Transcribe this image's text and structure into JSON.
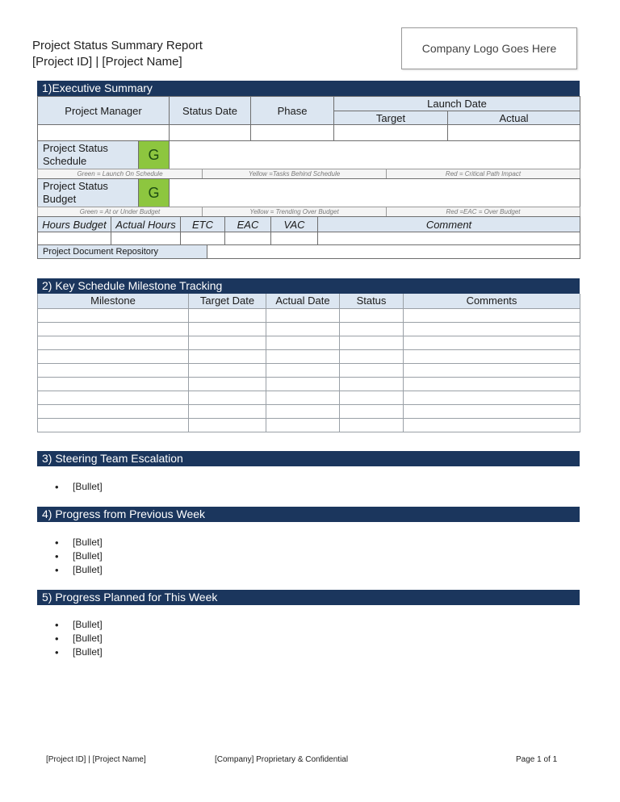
{
  "header": {
    "title": "Project Status Summary Report",
    "subtitle": "[Project ID] | [Project Name]",
    "logo_placeholder": "Company Logo Goes Here"
  },
  "section1": {
    "title": "1)Executive Summary",
    "columns": {
      "project_manager": "Project Manager",
      "status_date": "Status Date",
      "phase": "Phase",
      "launch_date": "Launch Date",
      "target": "Target",
      "actual": "Actual"
    },
    "values": {
      "project_manager": "",
      "status_date": "",
      "phase": "",
      "target": "",
      "actual": ""
    },
    "schedule": {
      "label": "Project Status Schedule",
      "status": "G",
      "status_color": "#8dc63f",
      "comment": "",
      "legend": {
        "green": "Green = Launch On Schedule",
        "yellow": "Yellow =Tasks Behind Schedule",
        "red": "Red = Critical Path Impact"
      }
    },
    "budget": {
      "label": "Project Status Budget",
      "status": "G",
      "status_color": "#8dc63f",
      "comment": "",
      "legend": {
        "green": "Green = At or Under Budget",
        "yellow": "Yellow = Trending Over Budget",
        "red": "Red =EAC = Over Budget"
      }
    },
    "hours": {
      "headers": [
        "Hours Budget",
        "Actual Hours",
        "ETC",
        "EAC",
        "VAC",
        "Comment"
      ],
      "values": [
        "",
        "",
        "",
        "",
        "",
        ""
      ]
    },
    "repository": {
      "label": "Project Document Repository",
      "value": ""
    }
  },
  "section2": {
    "title": "2) Key Schedule Milestone Tracking",
    "headers": [
      "Milestone",
      "Target Date",
      "Actual Date",
      "Status",
      "Comments"
    ],
    "rows": [
      [
        "",
        "",
        "",
        "",
        ""
      ],
      [
        "",
        "",
        "",
        "",
        ""
      ],
      [
        "",
        "",
        "",
        "",
        ""
      ],
      [
        "",
        "",
        "",
        "",
        ""
      ],
      [
        "",
        "",
        "",
        "",
        ""
      ],
      [
        "",
        "",
        "",
        "",
        ""
      ],
      [
        "",
        "",
        "",
        "",
        ""
      ],
      [
        "",
        "",
        "",
        "",
        ""
      ],
      [
        "",
        "",
        "",
        "",
        ""
      ]
    ]
  },
  "section3": {
    "title": "3) Steering Team Escalation",
    "bullets": [
      "[Bullet]"
    ]
  },
  "section4": {
    "title": "4) Progress from Previous Week",
    "bullets": [
      "[Bullet]",
      "[Bullet]",
      "[Bullet]"
    ]
  },
  "section5": {
    "title": "5) Progress Planned for This Week",
    "bullets": [
      "[Bullet]",
      "[Bullet]",
      "[Bullet]"
    ]
  },
  "footer": {
    "left": "[Project ID] | [Project Name]",
    "center": "[Company] Proprietary & Confidential",
    "right": "Page 1 of 1"
  },
  "colors": {
    "section_bar": "#1b365d",
    "header_fill": "#dce6f1",
    "status_green": "#8dc63f"
  }
}
